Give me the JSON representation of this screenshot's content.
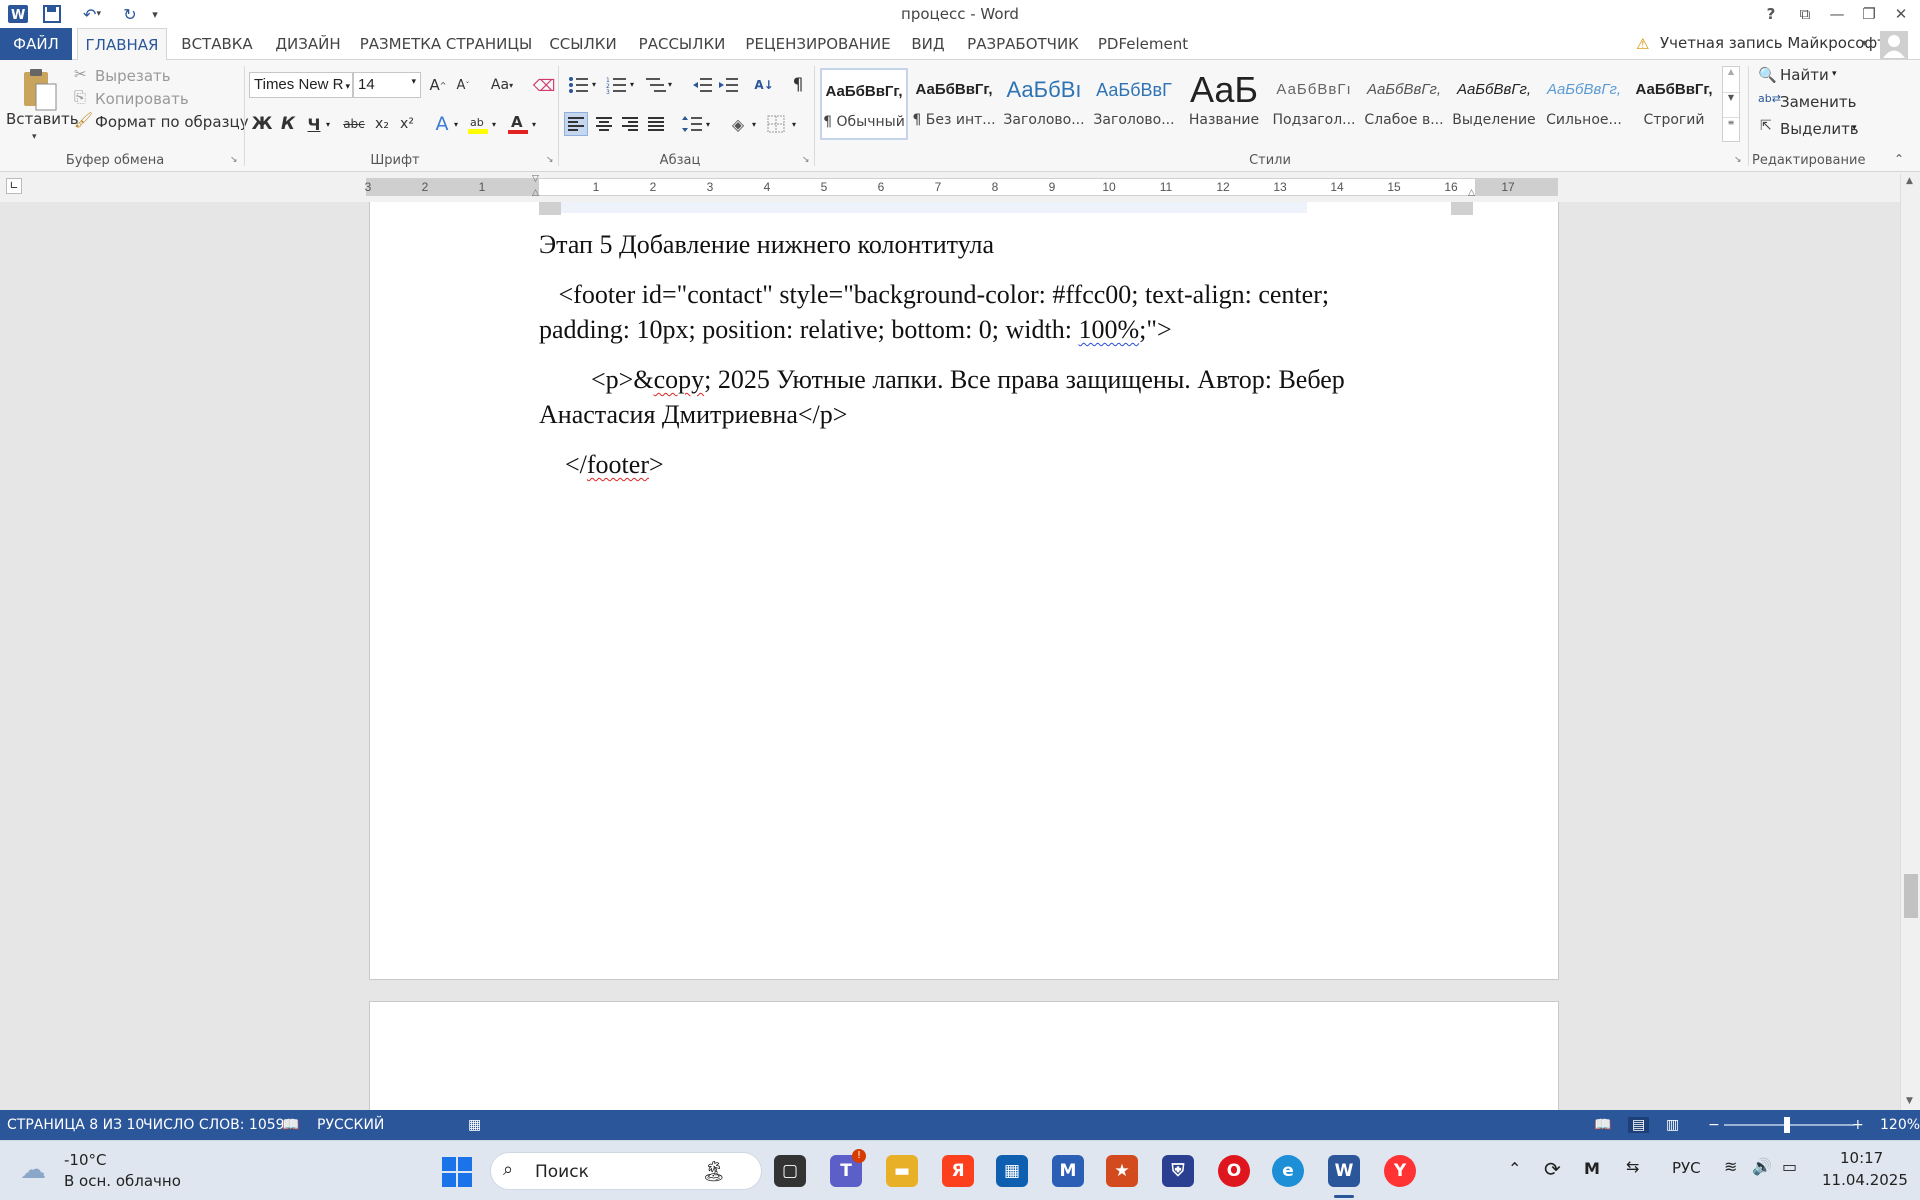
{
  "window": {
    "title": "процесс - Word",
    "help": "?",
    "account_warning": "Учетная запись Майкрософт",
    "avatar_icon": "user-avatar-icon"
  },
  "tabs": {
    "file": "ФАЙЛ",
    "home": "ГЛАВНАЯ",
    "insert": "ВСТАВКА",
    "design": "ДИЗАЙН",
    "layout": "РАЗМЕТКА СТРАНИЦЫ",
    "references": "ССЫЛКИ",
    "mailings": "РАССЫЛКИ",
    "review": "РЕЦЕНЗИРОВАНИЕ",
    "view": "ВИД",
    "developer": "РАЗРАБОТЧИК",
    "pdfelement": "PDFelement"
  },
  "clipboard": {
    "paste": "Вставить",
    "cut": "Вырезать",
    "copy": "Копировать",
    "format_painter": "Формат по образцу",
    "group_label": "Буфер обмена"
  },
  "font": {
    "font_name": "Times New R",
    "font_size": "14",
    "grow": "A",
    "shrink": "A",
    "case": "Aa",
    "bold": "Ж",
    "italic": "К",
    "underline": "Ч",
    "strike": "abc",
    "subscript": "x₂",
    "superscript": "x²",
    "group_label": "Шрифт"
  },
  "paragraph": {
    "pilcrow": "¶",
    "group_label": "Абзац"
  },
  "styles": {
    "items": [
      {
        "sample": "АаБбВвГг,",
        "name": "¶ Обычный"
      },
      {
        "sample": "АаБбВвГг,",
        "name": "¶ Без инт..."
      },
      {
        "sample": "АаБбВı",
        "name": "Заголово..."
      },
      {
        "sample": "АаБбВвГ",
        "name": "Заголово..."
      },
      {
        "sample": "АаБ",
        "name": "Название"
      },
      {
        "sample": "АаБбВвГı",
        "name": "Подзагол..."
      },
      {
        "sample": "АаБбВвГг,",
        "name": "Слабое в..."
      },
      {
        "sample": "АаБбВвГг,",
        "name": "Выделение"
      },
      {
        "sample": "АаБбВвГг,",
        "name": "Сильное..."
      },
      {
        "sample": "АаБбВвГг,",
        "name": "Строгий"
      }
    ],
    "group_label": "Стили"
  },
  "editing": {
    "find": "Найти",
    "replace": "Заменить",
    "select": "Выделить",
    "group_label": "Редактирование"
  },
  "ruler": {
    "numbers": [
      "3",
      "2",
      "1",
      "1",
      "2",
      "3",
      "4",
      "5",
      "6",
      "7",
      "8",
      "9",
      "10",
      "11",
      "12",
      "13",
      "14",
      "15",
      "16",
      "17"
    ]
  },
  "document": {
    "heading": "Этап 5 Добавление нижнего колонтитула",
    "line1a": "   <footer id=\"contact\" style=\"background-color: #ffcc00; text-align: center;",
    "line1b_pre": "padding: 10px; position: relative; bottom: 0; width: ",
    "line1b_sq": "100%",
    "line1b_post": ";\">",
    "line2a_pre": "        <p>&",
    "line2a_sq": "copy",
    "line2a_post": "; 2025 Уютные лапки. Все права защищены. Автор: Вебер",
    "line2b": "Анастасия Дмитриевна</p>",
    "line3_pre": "    </",
    "line3_sq": "footer",
    "line3_post": ">"
  },
  "status": {
    "page": "СТРАНИЦА 8 ИЗ 10",
    "words": "ЧИСЛО СЛОВ: 1059",
    "language": "РУССКИЙ",
    "zoom": "120%"
  },
  "taskbar": {
    "temp": "-10°C",
    "weather": "В осн. облачно",
    "search": "Поиск",
    "lang": "РУС",
    "time": "10:17",
    "date": "11.04.2025",
    "yandex": "Я"
  },
  "colors": {
    "word_blue": "#2b579a",
    "spell_red": "#dd2222",
    "grammar_blue": "#2a4bd7"
  }
}
